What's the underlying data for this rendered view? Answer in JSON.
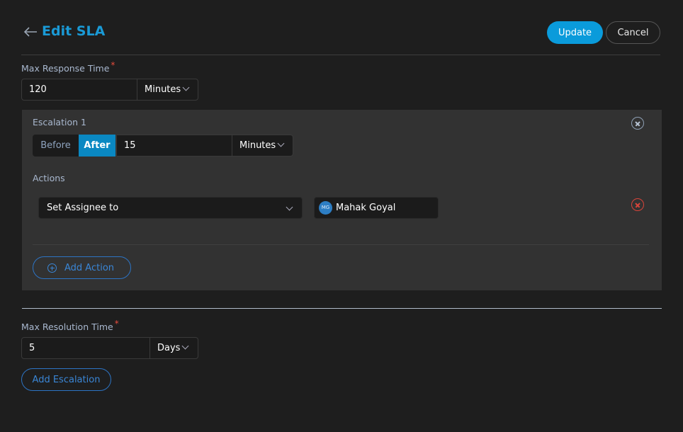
{
  "header": {
    "title": "Edit SLA",
    "update_label": "Update",
    "cancel_label": "Cancel"
  },
  "response_time": {
    "label": "Max Response Time",
    "required_mark": "*",
    "value": "120",
    "unit": "Minutes"
  },
  "escalations": [
    {
      "title": "Escalation 1",
      "timing_options": [
        "Before",
        "After"
      ],
      "timing_selected": "After",
      "value": "15",
      "unit": "Minutes",
      "actions_label": "Actions",
      "actions": [
        {
          "type": "Set Assignee to",
          "assignee": {
            "initials": "MG",
            "name": "Mahak Goyal"
          }
        }
      ],
      "add_action_label": "Add Action"
    }
  ],
  "resolution_time": {
    "label": "Max Resolution Time",
    "required_mark": "*",
    "value": "5",
    "unit": "Days"
  },
  "add_escalation_label": "Add Escalation",
  "colors": {
    "accent": "#0a9bdb",
    "title": "#1a9ad6",
    "danger": "#d9443a",
    "link": "#3a86d6"
  }
}
